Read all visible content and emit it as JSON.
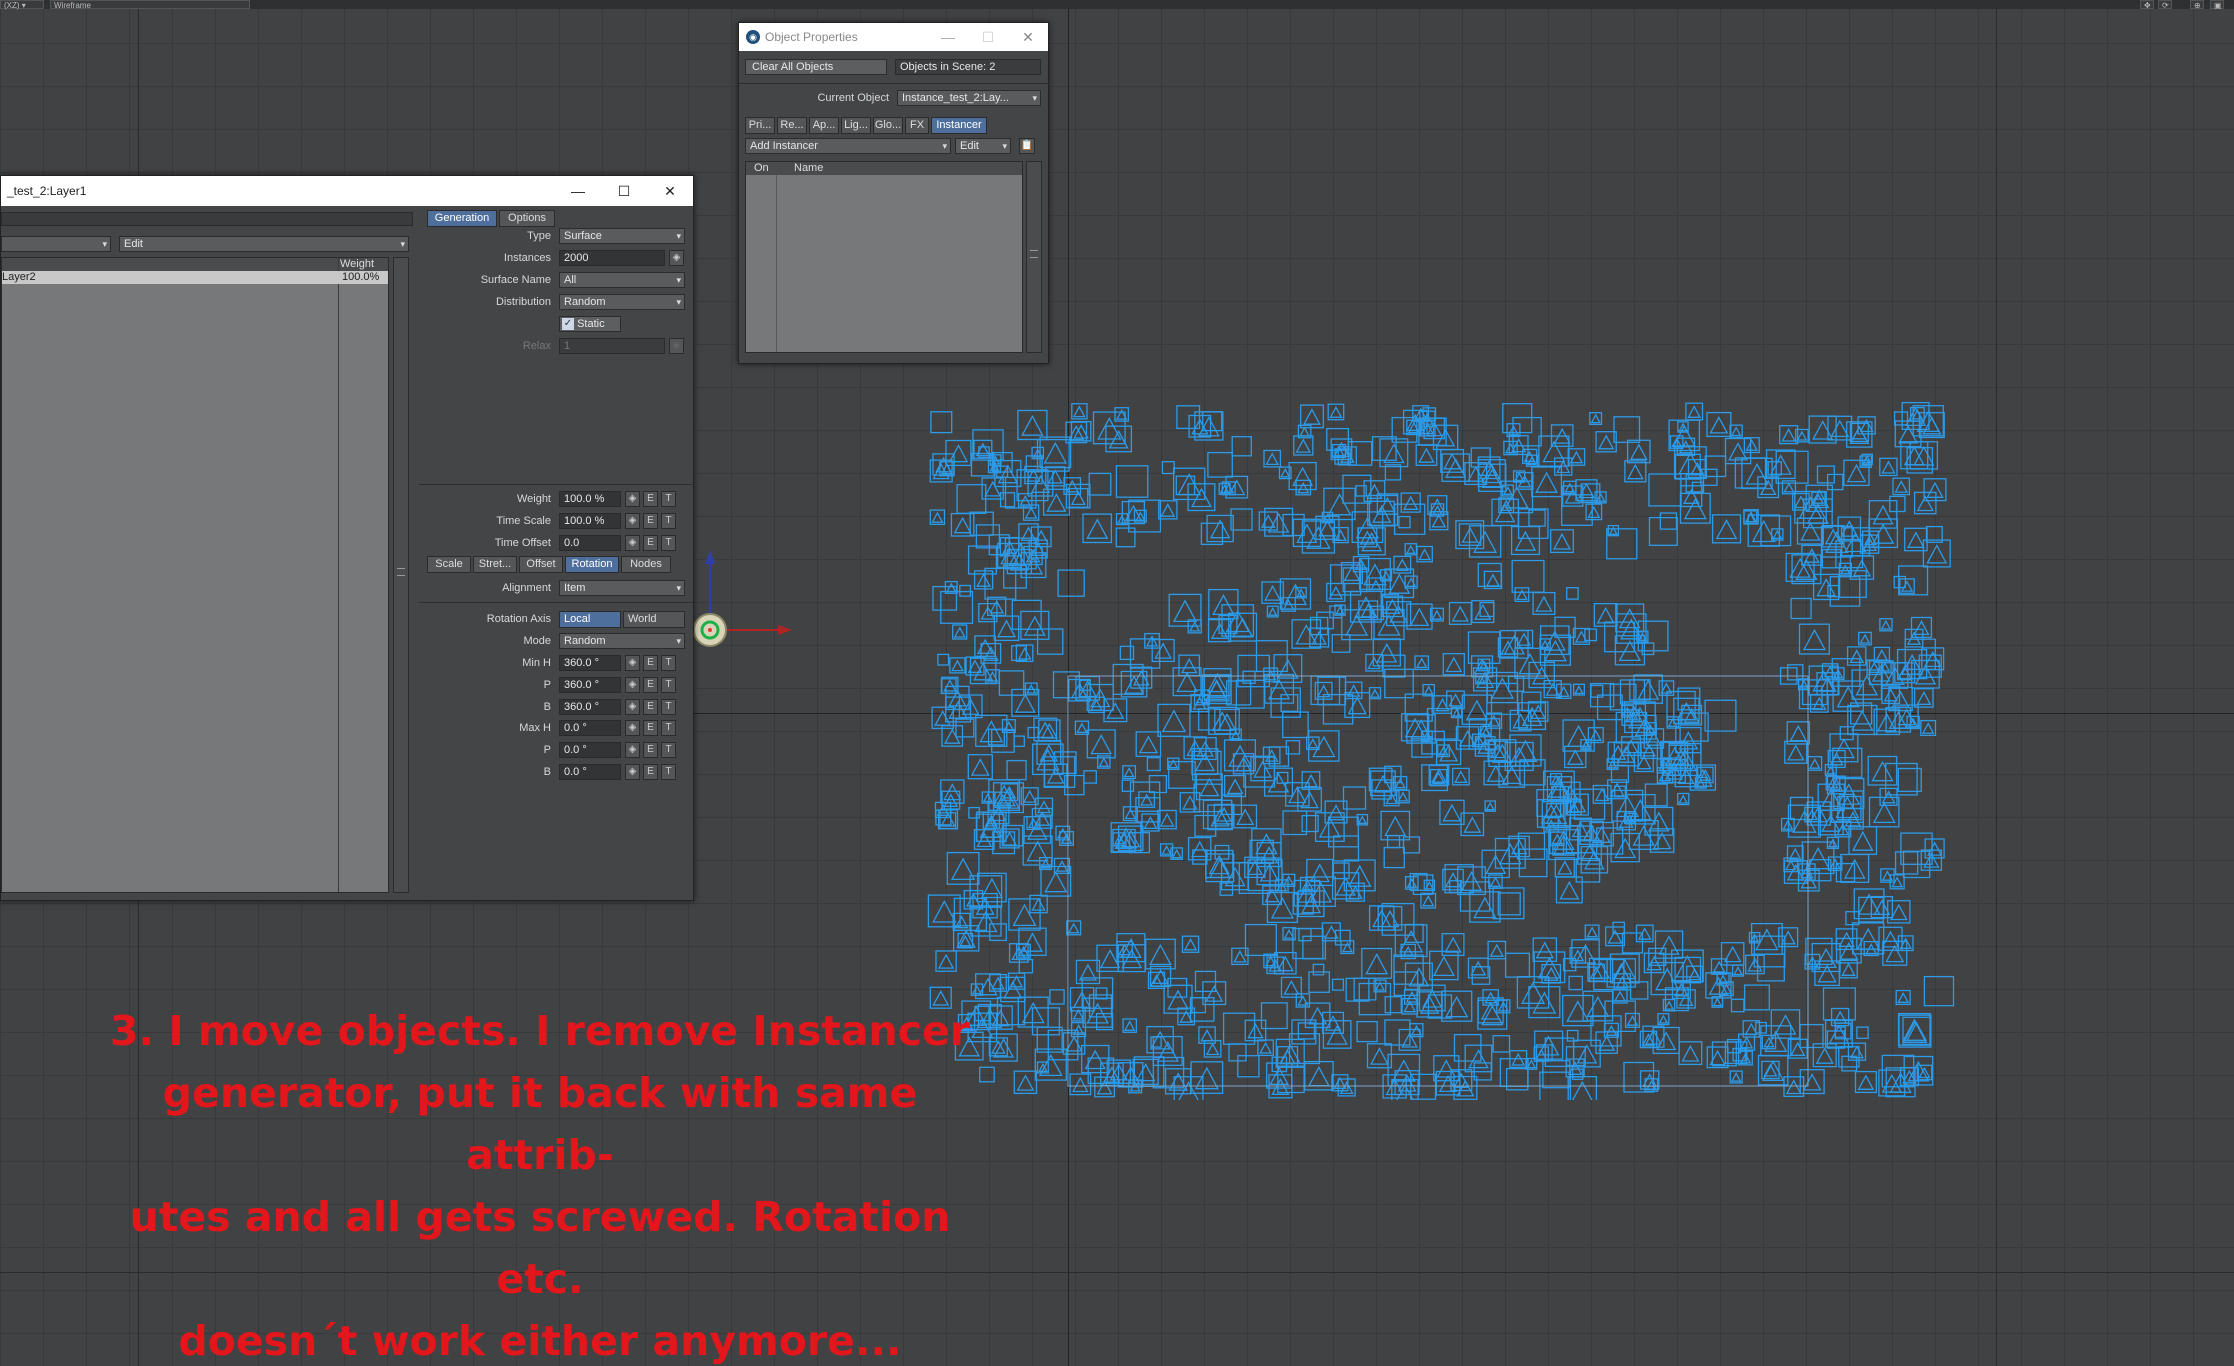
{
  "viewport": {
    "mode_label": "(XZ)",
    "shading_label": "Wireframe"
  },
  "instancer_window": {
    "title": "_test_2:Layer1",
    "left_dropdown": "",
    "edit_dropdown": "Edit",
    "list_header_weight": "Weight",
    "list_rows": [
      {
        "name": "Layer2",
        "weight": "100.0%"
      }
    ],
    "tabs": [
      "Generation",
      "Options"
    ],
    "active_tab": "Generation",
    "generation": {
      "type_label": "Type",
      "type_value": "Surface",
      "instances_label": "Instances",
      "instances_value": "2000",
      "surface_name_label": "Surface Name",
      "surface_name_value": "All",
      "distribution_label": "Distribution",
      "distribution_value": "Random",
      "static_label": "Static",
      "static_checked": true,
      "relax_label": "Relax",
      "relax_value": "1"
    },
    "weights": {
      "weight_label": "Weight",
      "weight_value": "100.0 %",
      "time_scale_label": "Time Scale",
      "time_scale_value": "100.0 %",
      "time_offset_label": "Time Offset",
      "time_offset_value": "0.0"
    },
    "sub_tabs": [
      "Scale",
      "Stret...",
      "Offset",
      "Rotation",
      "Nodes"
    ],
    "active_sub_tab": "Rotation",
    "rotation": {
      "alignment_label": "Alignment",
      "alignment_value": "Item",
      "axis_label": "Rotation Axis",
      "axis_local": "Local",
      "axis_world": "World",
      "axis_selected": "Local",
      "mode_label": "Mode",
      "mode_value": "Random",
      "min_h_label": "Min H",
      "min_h_value": "360.0 °",
      "min_p_label": "P",
      "min_p_value": "360.0 °",
      "min_b_label": "B",
      "min_b_value": "360.0 °",
      "max_h_label": "Max H",
      "max_h_value": "0.0 °",
      "max_p_label": "P",
      "max_p_value": "0.0 °",
      "max_b_label": "B",
      "max_b_value": "0.0 °"
    },
    "env_buttons": {
      "e": "E",
      "t": "T"
    }
  },
  "object_properties": {
    "title": "Object Properties",
    "clear_all_label": "Clear All Objects",
    "objects_in_scene": "Objects in Scene: 2",
    "current_object_label": "Current Object",
    "current_object_value": "Instance_test_2:Lay...",
    "tabs": [
      "Pri...",
      "Re...",
      "Ap...",
      "Lig...",
      "Glo...",
      "FX",
      "Instancer"
    ],
    "active_tab": "Instancer",
    "add_instancer_label": "Add Instancer",
    "edit_label": "Edit",
    "col_on": "On",
    "col_name": "Name"
  },
  "caption": {
    "lines": [
      "3. I move objects. I remove Instancer",
      "generator, put it back with same attrib-",
      "utes and all gets screwed. Rotation etc.",
      "doesn´t work either anymore..."
    ]
  },
  "colors": {
    "viewport_bg": "#414244",
    "instance_blue": "#2d9be8",
    "caption_red": "#e3161b",
    "active_tab": "#4e6e9b"
  }
}
